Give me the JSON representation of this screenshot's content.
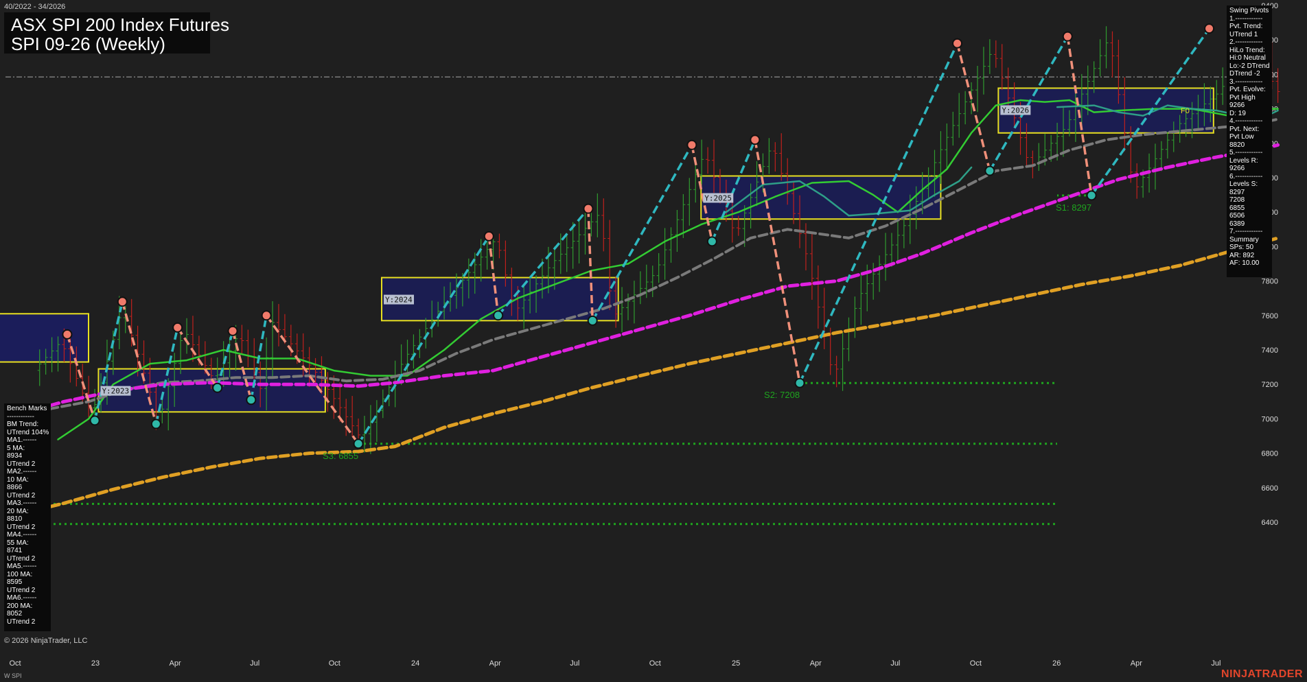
{
  "header": {
    "date_range": "40/2022 - 34/2026",
    "title": "ASX SPI 200 Index Futures",
    "subtitle": "SPI 09-26 (Weekly)"
  },
  "footer": {
    "copyright": "© 2026 NinjaTrader, LLC",
    "instrument": "W SPI",
    "brand": "NINJATRADER"
  },
  "swing_panel": {
    "lines": [
      "Swing Pivots",
      "1.------------",
      "Pvt. Trend:",
      "UTrend 1",
      "2.------------",
      "HiLo Trend:",
      "Hi:0 Neutral",
      "Lo:-2 DTrend",
      "DTrend -2",
      "3.------------",
      "Pvt. Evolve:",
      "Pvt High",
      "9266",
      "D: 19",
      "4.------------",
      "Pvt. Next:",
      "Pvt Low",
      "8820",
      "5.------------",
      "Levels R:",
      "9266",
      "6.------------",
      "Levels S:",
      "8297",
      "7208",
      "6855",
      "6506",
      "6389",
      "7.------------",
      "Summary",
      "SPs: 50",
      "AR: 892",
      "AF: 10.00"
    ]
  },
  "bench_panel": {
    "lines": [
      "Bench Marks",
      "------------",
      "BM Trend:",
      "UTrend 104%",
      "MA1.------",
      "5 MA:",
      "8934",
      "UTrend 2",
      "MA2.------",
      "10 MA:",
      "8866",
      "UTrend 2",
      "MA3.------",
      "20 MA:",
      "8810",
      "UTrend 2",
      "MA4.------",
      "55 MA:",
      "8741",
      "UTrend 2",
      "MA5.------",
      "100 MA:",
      "8595",
      "UTrend 2",
      "MA6.------",
      "200 MA:",
      "8052",
      "UTrend 2"
    ]
  },
  "colors": {
    "background": "#1f1f1f",
    "up_bar": "#2f9b2f",
    "down_bar": "#c0201d",
    "ma_green": "#33cc33",
    "ma_teal": "#2e9f88",
    "ma_grey": "#7a7a7a",
    "ma_magenta": "#e020e0",
    "ma_orange": "#e0a024",
    "swing_up": "#2fb8c0",
    "swing_down": "#f0907a",
    "pivot_high": "#f07a6a",
    "pivot_low": "#2fb8a8",
    "support": "#1fa51f",
    "box_fill": "#1b1d5a",
    "box_stroke": "#e8e020",
    "brand": "#e2452b"
  },
  "chart_data": {
    "type": "line",
    "title": "ASX SPI 200 Index Futures",
    "subtitle": "SPI 09-26 (Weekly)",
    "ylim": [
      6300,
      9400
    ],
    "y_ticks": [
      6400,
      6600,
      6800,
      7000,
      7200,
      7400,
      7600,
      7800,
      8000,
      8200,
      8400,
      8600,
      8800,
      9000,
      9200,
      9400
    ],
    "x_ticks": [
      {
        "label": "Oct",
        "t": 0.0
      },
      {
        "label": "23",
        "t": 13.1
      },
      {
        "label": "Apr",
        "t": 26.1
      },
      {
        "label": "Jul",
        "t": 39.1
      },
      {
        "label": "Oct",
        "t": 52.1
      },
      {
        "label": "24",
        "t": 65.3
      },
      {
        "label": "Apr",
        "t": 78.3
      },
      {
        "label": "Jul",
        "t": 91.3
      },
      {
        "label": "Oct",
        "t": 104.4
      },
      {
        "label": "25",
        "t": 117.6
      },
      {
        "label": "Apr",
        "t": 130.6
      },
      {
        "label": "Jul",
        "t": 143.6
      },
      {
        "label": "Oct",
        "t": 156.7
      },
      {
        "label": "26",
        "t": 169.9
      },
      {
        "label": "Apr",
        "t": 182.9
      },
      {
        "label": "Jul",
        "t": 195.9
      }
    ],
    "t_range": [
      0,
      207
    ],
    "price_anchors": [
      [
        0,
        7150
      ],
      [
        4,
        7300
      ],
      [
        8,
        7450
      ],
      [
        13,
        7020
      ],
      [
        18,
        7650
      ],
      [
        24,
        6990
      ],
      [
        28,
        7520
      ],
      [
        33,
        7220
      ],
      [
        37,
        7500
      ],
      [
        41,
        7130
      ],
      [
        42,
        7580
      ],
      [
        50,
        7250
      ],
      [
        57,
        6880
      ],
      [
        64,
        7350
      ],
      [
        70,
        7650
      ],
      [
        79,
        8050
      ],
      [
        82,
        7620
      ],
      [
        88,
        7900
      ],
      [
        96,
        8200
      ],
      [
        98,
        7590
      ],
      [
        105,
        7850
      ],
      [
        113,
        8550
      ],
      [
        118,
        8060
      ],
      [
        124,
        8600
      ],
      [
        130,
        7900
      ],
      [
        134,
        7230
      ],
      [
        138,
        7700
      ],
      [
        146,
        8150
      ],
      [
        152,
        8600
      ],
      [
        160,
        9150
      ],
      [
        166,
        8460
      ],
      [
        172,
        8700
      ],
      [
        179,
        9220
      ],
      [
        183,
        8320
      ],
      [
        190,
        8700
      ],
      [
        197,
        8900
      ],
      [
        203,
        9260
      ],
      [
        206,
        8900
      ]
    ],
    "series": [
      {
        "name": "MA1 5 MA",
        "color": "#33cc33",
        "values": [
          [
            7,
            6880
          ],
          [
            12,
            7000
          ],
          [
            16,
            7200
          ],
          [
            22,
            7320
          ],
          [
            28,
            7340
          ],
          [
            34,
            7400
          ],
          [
            40,
            7350
          ],
          [
            46,
            7350
          ],
          [
            52,
            7280
          ],
          [
            58,
            7250
          ],
          [
            64,
            7250
          ],
          [
            70,
            7400
          ],
          [
            76,
            7580
          ],
          [
            82,
            7700
          ],
          [
            88,
            7780
          ],
          [
            94,
            7860
          ],
          [
            100,
            7900
          ],
          [
            106,
            8030
          ],
          [
            112,
            8130
          ],
          [
            118,
            8200
          ],
          [
            124,
            8290
          ],
          [
            130,
            8370
          ],
          [
            136,
            8380
          ],
          [
            140,
            8300
          ],
          [
            144,
            8200
          ],
          [
            148,
            8330
          ],
          [
            152,
            8450
          ],
          [
            156,
            8660
          ],
          [
            160,
            8820
          ],
          [
            164,
            8850
          ],
          [
            168,
            8840
          ],
          [
            172,
            8850
          ],
          [
            176,
            8780
          ],
          [
            180,
            8790
          ],
          [
            186,
            8800
          ],
          [
            192,
            8800
          ],
          [
            198,
            8760
          ],
          [
            203,
            8800
          ],
          [
            206,
            8800
          ]
        ]
      },
      {
        "name": "MA3 20 MA",
        "color": "#2e9f88",
        "values": [
          [
            116,
            8200
          ],
          [
            122,
            8360
          ],
          [
            128,
            8380
          ],
          [
            132,
            8290
          ],
          [
            136,
            8180
          ],
          [
            140,
            8190
          ],
          [
            146,
            8210
          ],
          [
            150,
            8300
          ],
          [
            154,
            8380
          ],
          [
            156,
            8460
          ]
        ]
      },
      {
        "name": "MA3 20 MA (2026)",
        "color": "#2e9f88",
        "values": [
          [
            170,
            8810
          ],
          [
            176,
            8820
          ],
          [
            180,
            8780
          ],
          [
            184,
            8760
          ],
          [
            188,
            8820
          ],
          [
            192,
            8800
          ],
          [
            196,
            8790
          ],
          [
            200,
            8760
          ],
          [
            203,
            8740
          ],
          [
            206,
            8790
          ]
        ]
      },
      {
        "name": "MA4 55 MA",
        "color": "#7a7a7a",
        "values": [
          [
            0,
            6980
          ],
          [
            6,
            7060
          ],
          [
            12,
            7100
          ],
          [
            18,
            7170
          ],
          [
            24,
            7210
          ],
          [
            30,
            7220
          ],
          [
            36,
            7240
          ],
          [
            42,
            7240
          ],
          [
            48,
            7250
          ],
          [
            54,
            7220
          ],
          [
            60,
            7230
          ],
          [
            66,
            7280
          ],
          [
            72,
            7380
          ],
          [
            78,
            7460
          ],
          [
            84,
            7520
          ],
          [
            90,
            7580
          ],
          [
            96,
            7640
          ],
          [
            102,
            7720
          ],
          [
            108,
            7820
          ],
          [
            114,
            7930
          ],
          [
            120,
            8050
          ],
          [
            126,
            8100
          ],
          [
            132,
            8070
          ],
          [
            136,
            8050
          ],
          [
            142,
            8120
          ],
          [
            148,
            8220
          ],
          [
            154,
            8330
          ],
          [
            160,
            8440
          ],
          [
            166,
            8470
          ],
          [
            172,
            8560
          ],
          [
            178,
            8620
          ],
          [
            184,
            8650
          ],
          [
            190,
            8670
          ],
          [
            196,
            8690
          ],
          [
            202,
            8710
          ],
          [
            206,
            8740
          ]
        ]
      },
      {
        "name": "MA5 100 MA",
        "color": "#e020e0",
        "values": [
          [
            0,
            7020
          ],
          [
            8,
            7100
          ],
          [
            16,
            7160
          ],
          [
            24,
            7200
          ],
          [
            32,
            7210
          ],
          [
            40,
            7200
          ],
          [
            48,
            7200
          ],
          [
            56,
            7190
          ],
          [
            62,
            7210
          ],
          [
            70,
            7250
          ],
          [
            78,
            7280
          ],
          [
            86,
            7360
          ],
          [
            94,
            7440
          ],
          [
            102,
            7520
          ],
          [
            110,
            7600
          ],
          [
            118,
            7690
          ],
          [
            126,
            7770
          ],
          [
            134,
            7800
          ],
          [
            140,
            7860
          ],
          [
            148,
            7960
          ],
          [
            156,
            8080
          ],
          [
            164,
            8190
          ],
          [
            172,
            8290
          ],
          [
            180,
            8390
          ],
          [
            188,
            8460
          ],
          [
            196,
            8520
          ],
          [
            204,
            8570
          ],
          [
            206,
            8590
          ]
        ]
      },
      {
        "name": "MA6 200 MA",
        "color": "#e0a024",
        "values": [
          [
            0,
            6440
          ],
          [
            8,
            6510
          ],
          [
            16,
            6590
          ],
          [
            24,
            6660
          ],
          [
            32,
            6720
          ],
          [
            40,
            6770
          ],
          [
            48,
            6800
          ],
          [
            56,
            6810
          ],
          [
            62,
            6840
          ],
          [
            70,
            6950
          ],
          [
            78,
            7030
          ],
          [
            86,
            7100
          ],
          [
            94,
            7180
          ],
          [
            102,
            7250
          ],
          [
            110,
            7320
          ],
          [
            118,
            7380
          ],
          [
            126,
            7440
          ],
          [
            134,
            7500
          ],
          [
            142,
            7550
          ],
          [
            150,
            7600
          ],
          [
            158,
            7660
          ],
          [
            166,
            7720
          ],
          [
            174,
            7780
          ],
          [
            182,
            7830
          ],
          [
            190,
            7890
          ],
          [
            198,
            7970
          ],
          [
            204,
            8030
          ],
          [
            206,
            8050
          ]
        ]
      }
    ],
    "swing_pivots": [
      {
        "t": 8.5,
        "price": 7490,
        "kind": "high"
      },
      {
        "t": 13.0,
        "price": 6990,
        "kind": "low"
      },
      {
        "t": 17.5,
        "price": 7680,
        "kind": "high"
      },
      {
        "t": 23.0,
        "price": 6970,
        "kind": "low"
      },
      {
        "t": 26.5,
        "price": 7530,
        "kind": "high"
      },
      {
        "t": 33.0,
        "price": 7180,
        "kind": "low"
      },
      {
        "t": 35.5,
        "price": 7510,
        "kind": "high"
      },
      {
        "t": 38.5,
        "price": 7110,
        "kind": "low"
      },
      {
        "t": 41.0,
        "price": 7600,
        "kind": "high"
      },
      {
        "t": 56.0,
        "price": 6855,
        "kind": "low"
      },
      {
        "t": 77.3,
        "price": 8060,
        "kind": "high"
      },
      {
        "t": 78.8,
        "price": 7600,
        "kind": "low"
      },
      {
        "t": 93.5,
        "price": 8220,
        "kind": "high"
      },
      {
        "t": 94.2,
        "price": 7570,
        "kind": "low"
      },
      {
        "t": 110.4,
        "price": 8590,
        "kind": "high"
      },
      {
        "t": 113.7,
        "price": 8030,
        "kind": "low"
      },
      {
        "t": 120.7,
        "price": 8620,
        "kind": "high"
      },
      {
        "t": 128.0,
        "price": 7208,
        "kind": "low"
      },
      {
        "t": 153.7,
        "price": 9180,
        "kind": "high"
      },
      {
        "t": 159.0,
        "price": 8440,
        "kind": "low"
      },
      {
        "t": 171.7,
        "price": 9220,
        "kind": "high"
      },
      {
        "t": 175.6,
        "price": 8297,
        "kind": "low"
      },
      {
        "t": 194.8,
        "price": 9266,
        "kind": "high"
      }
    ],
    "yearly_boxes": [
      {
        "label": "Y:2023",
        "t0": 13.6,
        "t1": 50.6,
        "low": 7040,
        "high": 7290
      },
      {
        "label": "Y:2024",
        "t0": 59.8,
        "t1": 98.4,
        "low": 7570,
        "high": 7820
      },
      {
        "label": "Y:2025",
        "t0": 111.9,
        "t1": 151.0,
        "low": 8160,
        "high": 8410
      },
      {
        "label": "Y:2026",
        "t0": 160.4,
        "t1": 195.5,
        "low": 8660,
        "high": 8920
      }
    ],
    "fo_label": "F0",
    "support_levels": [
      {
        "label": "S1: 8297",
        "price": 8297,
        "t0": 175.6
      },
      {
        "label": "S2: 7208",
        "price": 7208,
        "t0": 128.0
      },
      {
        "label": "S3: 6855",
        "price": 6855,
        "t0": 56.0
      },
      {
        "label": "",
        "price": 6506,
        "t0": 0
      },
      {
        "label": "",
        "price": 6389,
        "t0": 0
      }
    ],
    "ref_line_price": 8985
  }
}
